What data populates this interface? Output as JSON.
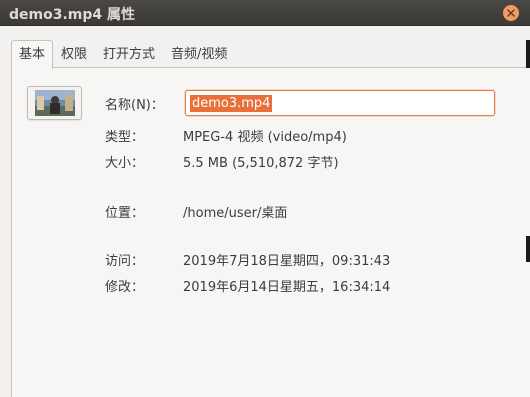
{
  "window": {
    "title": "demo3.mp4 属性"
  },
  "tabs": [
    {
      "label": "基本",
      "active": true
    },
    {
      "label": "权限",
      "active": false
    },
    {
      "label": "打开方式",
      "active": false
    },
    {
      "label": "音频/视频",
      "active": false
    }
  ],
  "basic": {
    "name_label": "名称(N)：",
    "name_value": "demo3.mp4",
    "type_label": "类型：",
    "type_value": "MPEG-4 视频 (video/mp4)",
    "size_label": "大小：",
    "size_value": "5.5 MB (5,510,872 字节)",
    "location_label": "位置：",
    "location_value": "/home/user/桌面",
    "accessed_label": "访问：",
    "accessed_value": "2019年7月18日星期四，09:31:43",
    "modified_label": "修改：",
    "modified_value": "2019年6月14日星期五，16:34:14"
  },
  "colors": {
    "accent": "#e9703a",
    "titlebar": "#3b3a36",
    "close_button": "#f39a5e"
  },
  "icons": {
    "close": "close-icon",
    "thumbnail": "video-thumbnail-icon"
  }
}
